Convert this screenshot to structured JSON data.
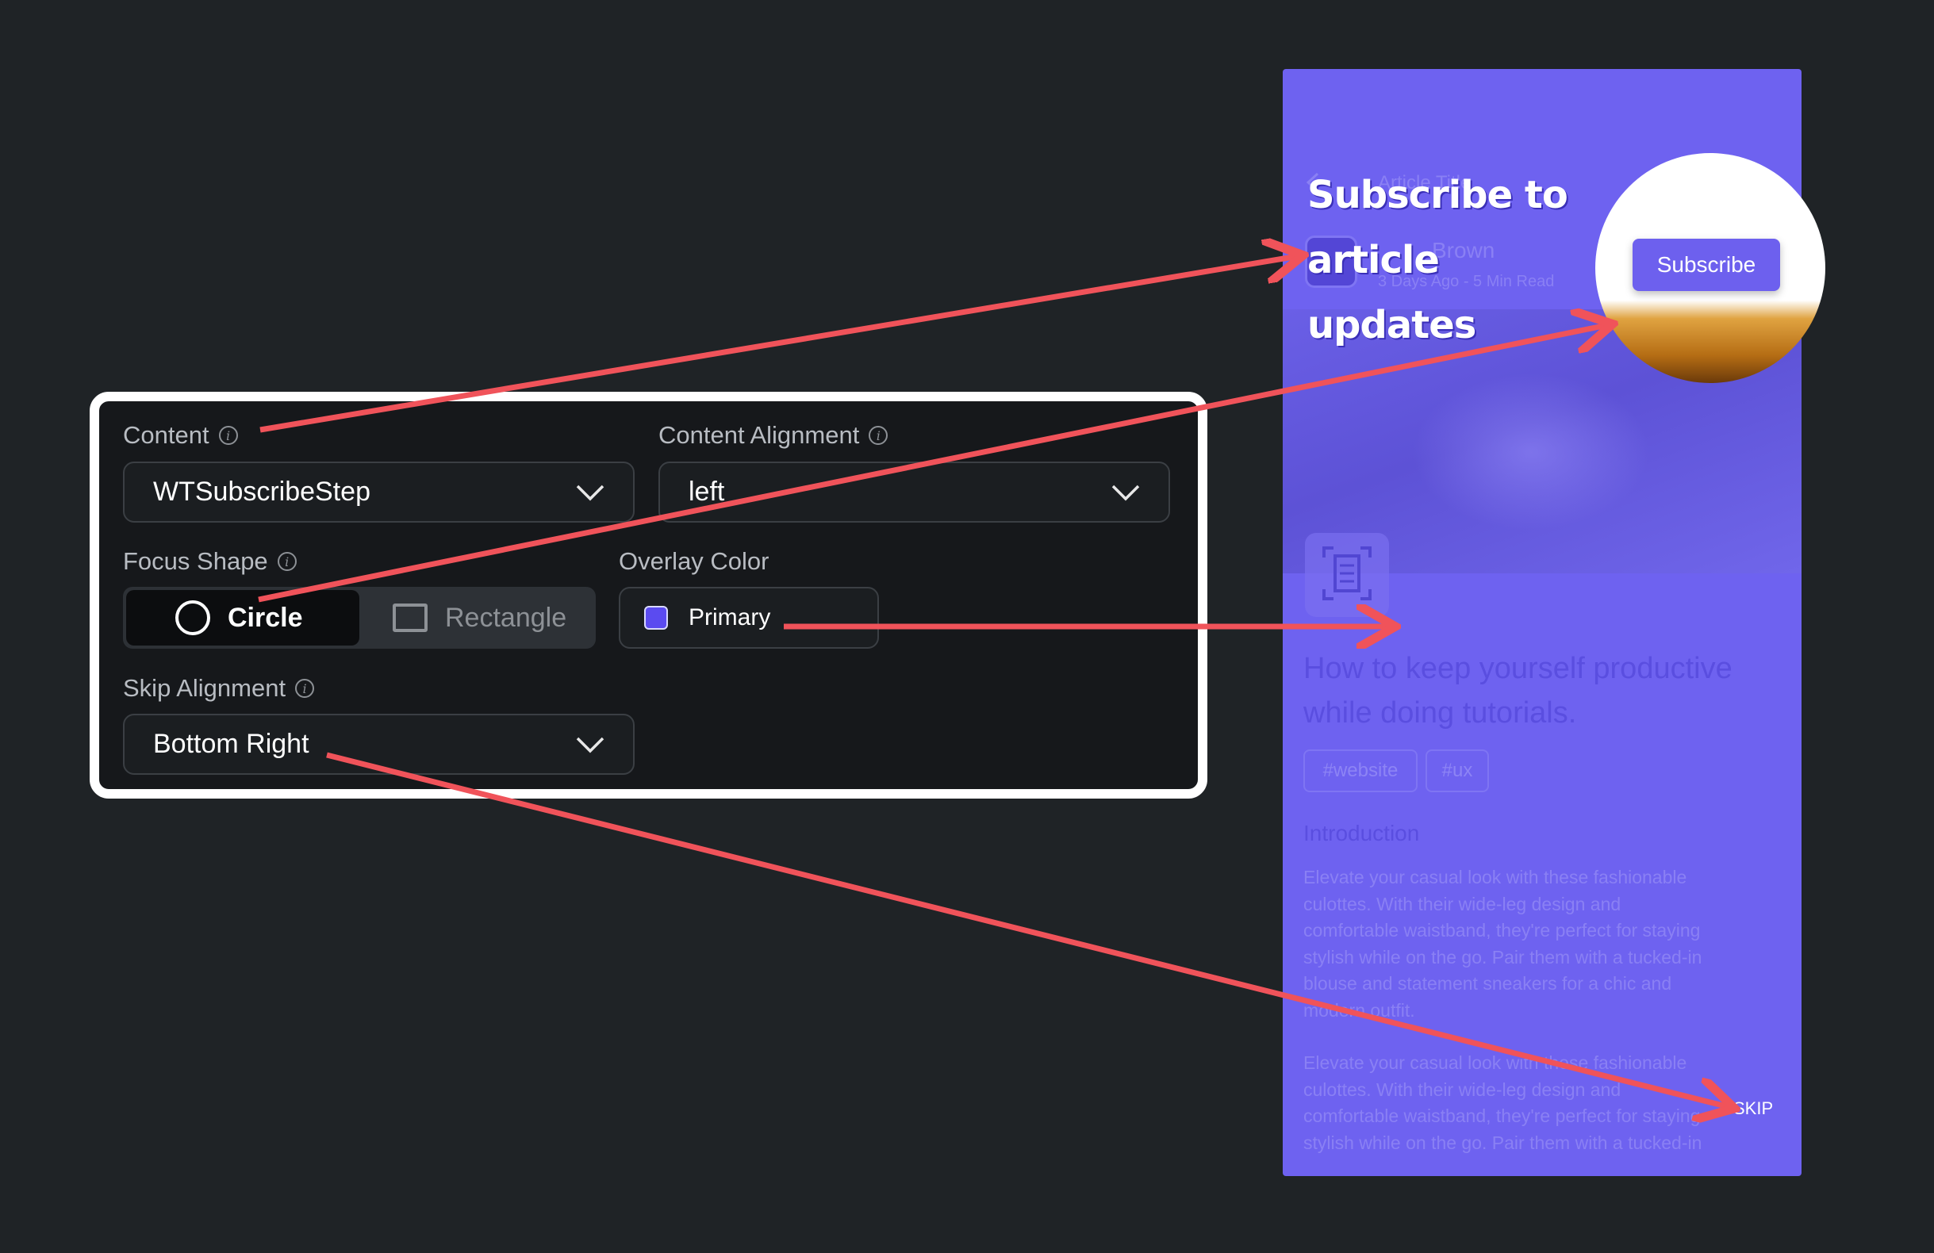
{
  "panel": {
    "content": {
      "label": "Content",
      "value": "WTSubscribeStep"
    },
    "content_alignment": {
      "label": "Content Alignment",
      "value": "left"
    },
    "focus_shape": {
      "label": "Focus Shape",
      "options": [
        "Circle",
        "Rectangle"
      ],
      "selected": "Circle"
    },
    "overlay_color": {
      "label": "Overlay Color",
      "value": "Primary",
      "swatch": "#5b4bf0"
    },
    "skip_alignment": {
      "label": "Skip Alignment",
      "value": "Bottom Right"
    }
  },
  "preview": {
    "header_title": "Article Title",
    "author": "Brown",
    "meta": "3 Days Ago - 5 Min Read",
    "annotation": [
      "Subscribe to",
      "article",
      "updates"
    ],
    "subscribe_button": "Subscribe",
    "article_title_lines": [
      "How to keep yourself productive",
      "while doing tutorials."
    ],
    "tags": [
      "#website",
      "#ux"
    ],
    "section_heading": "Introduction",
    "paragraph1_lines": [
      "Elevate your casual look with these fashionable",
      "culottes. With their wide-leg design and",
      "comfortable waistband, they're perfect for staying",
      "stylish while on the go. Pair them with a tucked-in",
      "blouse and statement sneakers for a chic and",
      "modern outfit."
    ],
    "paragraph2_lines": [
      "Elevate your casual look with these fashionable",
      "culottes. With their wide-leg design and",
      "comfortable waistband, they're perfect for staying",
      "stylish while on the go. Pair them with a tucked-in"
    ],
    "skip": "SKIP"
  },
  "colors": {
    "background": "#1f2326",
    "panel": "#16181b",
    "overlay": "#6e62f0",
    "arrow": "#f0535a"
  },
  "icons": [
    "info-icon",
    "chevron-down-icon",
    "circle-icon",
    "rectangle-icon",
    "document-scan-icon",
    "back-arrow-icon"
  ]
}
